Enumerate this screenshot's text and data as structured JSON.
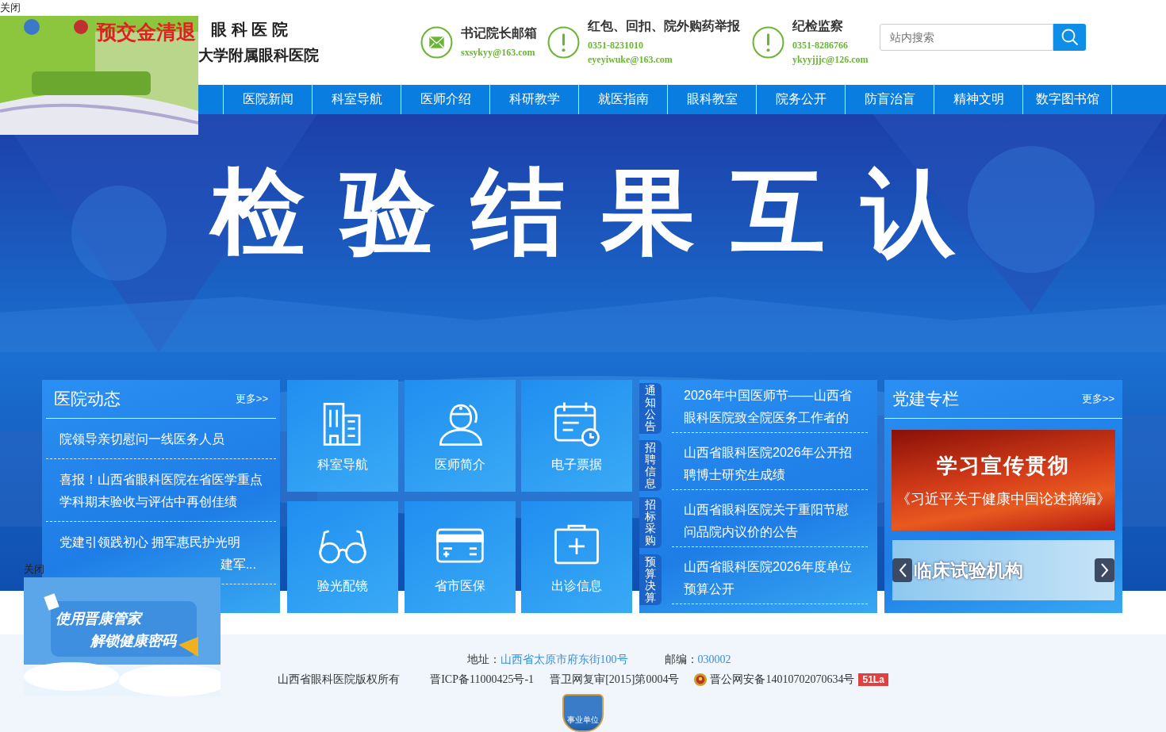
{
  "header": {
    "logo_lines": [
      "眼 科 医 院",
      "大学附属眼科医院"
    ],
    "contacts": [
      {
        "kind": "mail",
        "title": "书记院长邮箱",
        "lines": [
          "sxsykyy@163.com"
        ]
      },
      {
        "kind": "alert",
        "title": "红包、回扣、院外购药举报",
        "lines": [
          "0351-8231010",
          "eyeyiwuke@163.com"
        ]
      },
      {
        "kind": "alert",
        "title": "纪检监察",
        "lines": [
          "0351-8286766",
          "ykyyjjjc@126.com"
        ]
      }
    ],
    "search": {
      "placeholder": "站内搜索"
    }
  },
  "nav": [
    "医院新闻",
    "科室导航",
    "医师介绍",
    "科研教学",
    "就医指南",
    "眼科教室",
    "院务公开",
    "防盲治盲",
    "精神文明",
    "数字图书馆"
  ],
  "banner": {
    "title": "检验结果互认"
  },
  "news": {
    "title": "医院动态",
    "more": "更多>>",
    "items": [
      {
        "lines": [
          {
            "text": "院领导亲切慰问一线医务人员",
            "cut": false
          }
        ]
      },
      {
        "lines": [
          {
            "text": "喜报！山西省眼科医院在省医学重点",
            "cut": false
          },
          {
            "text": "学科期末验收与评估中再创佳绩",
            "cut": false
          }
        ]
      },
      {
        "lines": [
          {
            "text": "党建引领践初心 拥军惠民护光明",
            "cut": false
          },
          {
            "text": "建军...",
            "cut": true
          }
        ]
      }
    ]
  },
  "tiles": [
    {
      "kind": "building",
      "label": "科室导航"
    },
    {
      "kind": "doctor",
      "label": "医师简介"
    },
    {
      "kind": "calendar",
      "label": "电子票据"
    },
    {
      "kind": "glasses",
      "label": "验光配镜"
    },
    {
      "kind": "card",
      "label": "省市医保"
    },
    {
      "kind": "medkit",
      "label": "出诊信息"
    }
  ],
  "notices": [
    {
      "tag": "通知公告",
      "lines": [
        "2026年中国医师节——山西省",
        "眼科医院致全院医务工作者的"
      ]
    },
    {
      "tag": "招聘信息",
      "lines": [
        "山西省眼科医院2026年公开招",
        "聘博士研究生成绩"
      ]
    },
    {
      "tag": "招标采购",
      "lines": [
        "山西省眼科医院关于重阳节慰",
        "问品院内议价的公告"
      ]
    },
    {
      "tag": "预算决算",
      "lines": [
        "山西省眼科医院2026年度单位",
        "预算公开"
      ]
    }
  ],
  "party": {
    "title": "党建专栏",
    "more": "更多>>",
    "promo_lines": [
      "学习宣传贯彻",
      "《习近平关于健康中国论述摘编》"
    ],
    "slide_caption": "临床试验机构"
  },
  "footer": {
    "address_label": "地址：",
    "address": "山西省太原市府东街100号",
    "postcode_label": "邮编：",
    "postcode": "030002",
    "records": [
      "山西省眼科医院版权所有",
      "晋ICP备11000425号-1",
      "晋卫网复审[2015]第0004号"
    ],
    "police": "晋公网安备14010702070634号",
    "stat_badge": "51La",
    "unit_badge": "事业单位"
  },
  "floating_ads": [
    {
      "close": "关闭",
      "lines": [
        "预交金清退"
      ]
    },
    {
      "close": "关闭",
      "lines": [
        "使用晋康管家",
        "解锁健康密码"
      ]
    }
  ]
}
